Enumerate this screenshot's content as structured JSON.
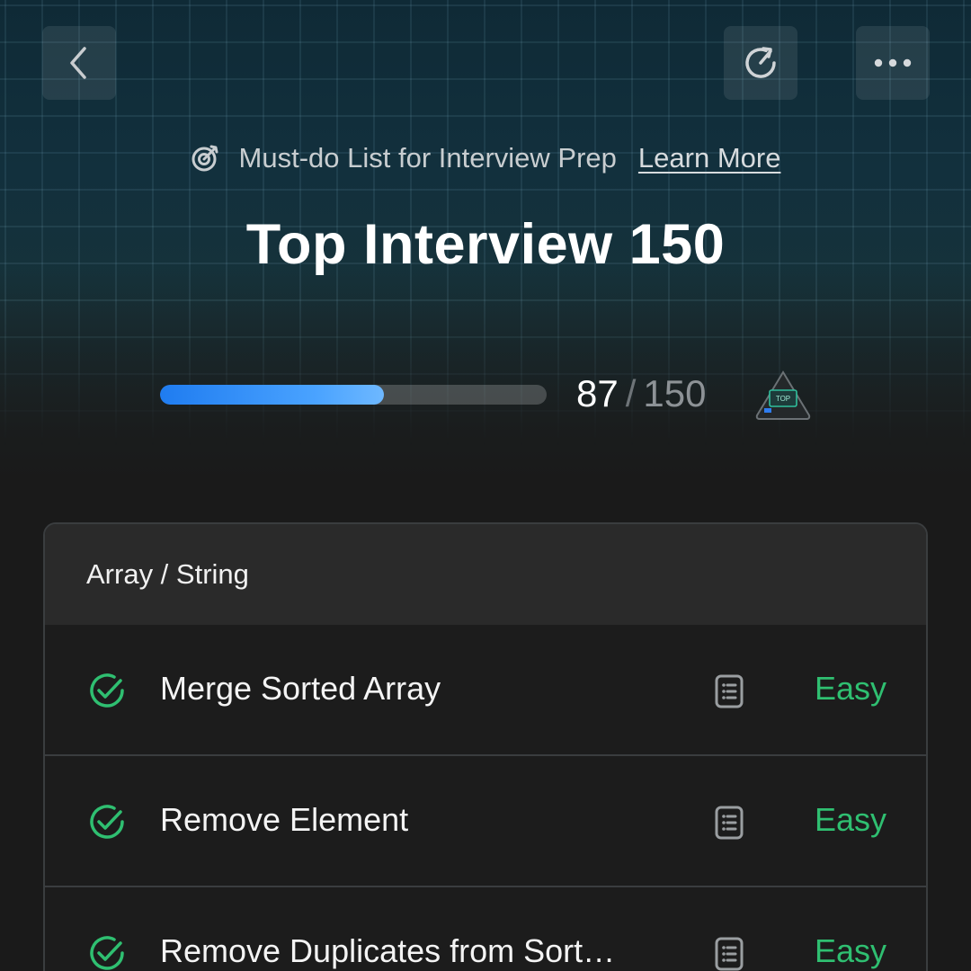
{
  "header": {
    "back_icon": "chevron-left-icon",
    "refresh_icon": "refresh-icon",
    "more_icon": "more-horizontal-icon"
  },
  "promo": {
    "icon": "target-icon",
    "text": "Must-do List for Interview Prep",
    "link": "Learn More"
  },
  "title": "Top Interview 150",
  "progress": {
    "solved": "87",
    "separator": "/",
    "total": "150",
    "fraction": 0.58,
    "badge_icon": "top-badge-icon",
    "badge_text": "TOP"
  },
  "section": {
    "title": "Array / String",
    "problems": [
      {
        "name": "Merge Sorted Array",
        "difficulty": "Easy",
        "status": "solved"
      },
      {
        "name": "Remove Element",
        "difficulty": "Easy",
        "status": "solved"
      },
      {
        "name": "Remove Duplicates from Sort…",
        "difficulty": "Easy",
        "status": "solved"
      }
    ]
  },
  "colors": {
    "accent_blue": "#1f7cf0",
    "easy_green": "#2fbf71",
    "background": "#1a1a1a"
  }
}
